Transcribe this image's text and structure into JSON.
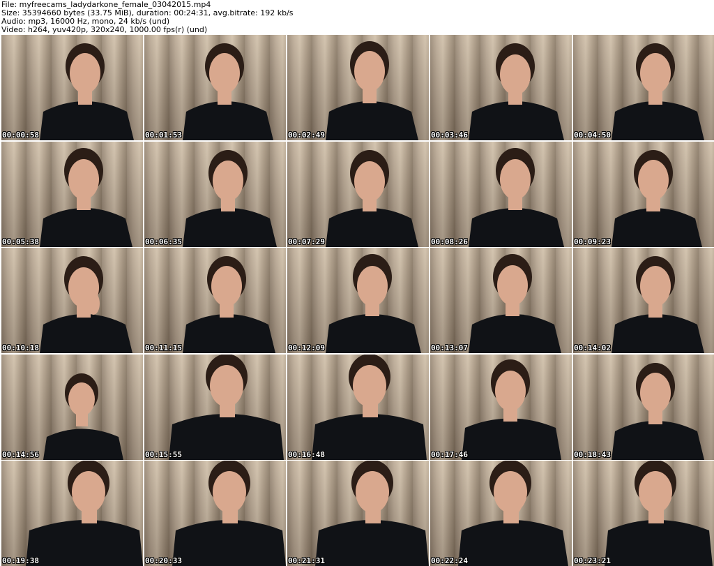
{
  "header": {
    "file": "File: myfreecams_ladydarkone_female_03042015.mp4",
    "size": "Size: 35394660 bytes (33.75 MiB), duration: 00:24:31, avg.bitrate: 192 kb/s",
    "audio": "Audio: mp3, 16000 Hz, mono, 24 kb/s (und)",
    "video": "Video: h264, yuv420p, 320x240, 1000.00 fps(r) (und)"
  },
  "colors": {
    "background": "#ffffff",
    "curtain": "#b3a391",
    "shirt": "#101216",
    "skin": "#d9a88e",
    "hair": "#2b1d16"
  },
  "thumbnails": [
    {
      "time": "00:00:58"
    },
    {
      "time": "00:01:53"
    },
    {
      "time": "00:02:49"
    },
    {
      "time": "00:03:46"
    },
    {
      "time": "00:04:50"
    },
    {
      "time": "00:05:38"
    },
    {
      "time": "00:06:35"
    },
    {
      "time": "00:07:29"
    },
    {
      "time": "00:08:26"
    },
    {
      "time": "00:09:23"
    },
    {
      "time": "00:10:18"
    },
    {
      "time": "00:11:15"
    },
    {
      "time": "00:12:09"
    },
    {
      "time": "00:13:07"
    },
    {
      "time": "00:14:02"
    },
    {
      "time": "00:14:56"
    },
    {
      "time": "00:15:55"
    },
    {
      "time": "00:16:48"
    },
    {
      "time": "00:17:46"
    },
    {
      "time": "00:18:43"
    },
    {
      "time": "00:19:38"
    },
    {
      "time": "00:20:33"
    },
    {
      "time": "00:21:31"
    },
    {
      "time": "00:22:24"
    },
    {
      "time": "00:23:21"
    }
  ]
}
